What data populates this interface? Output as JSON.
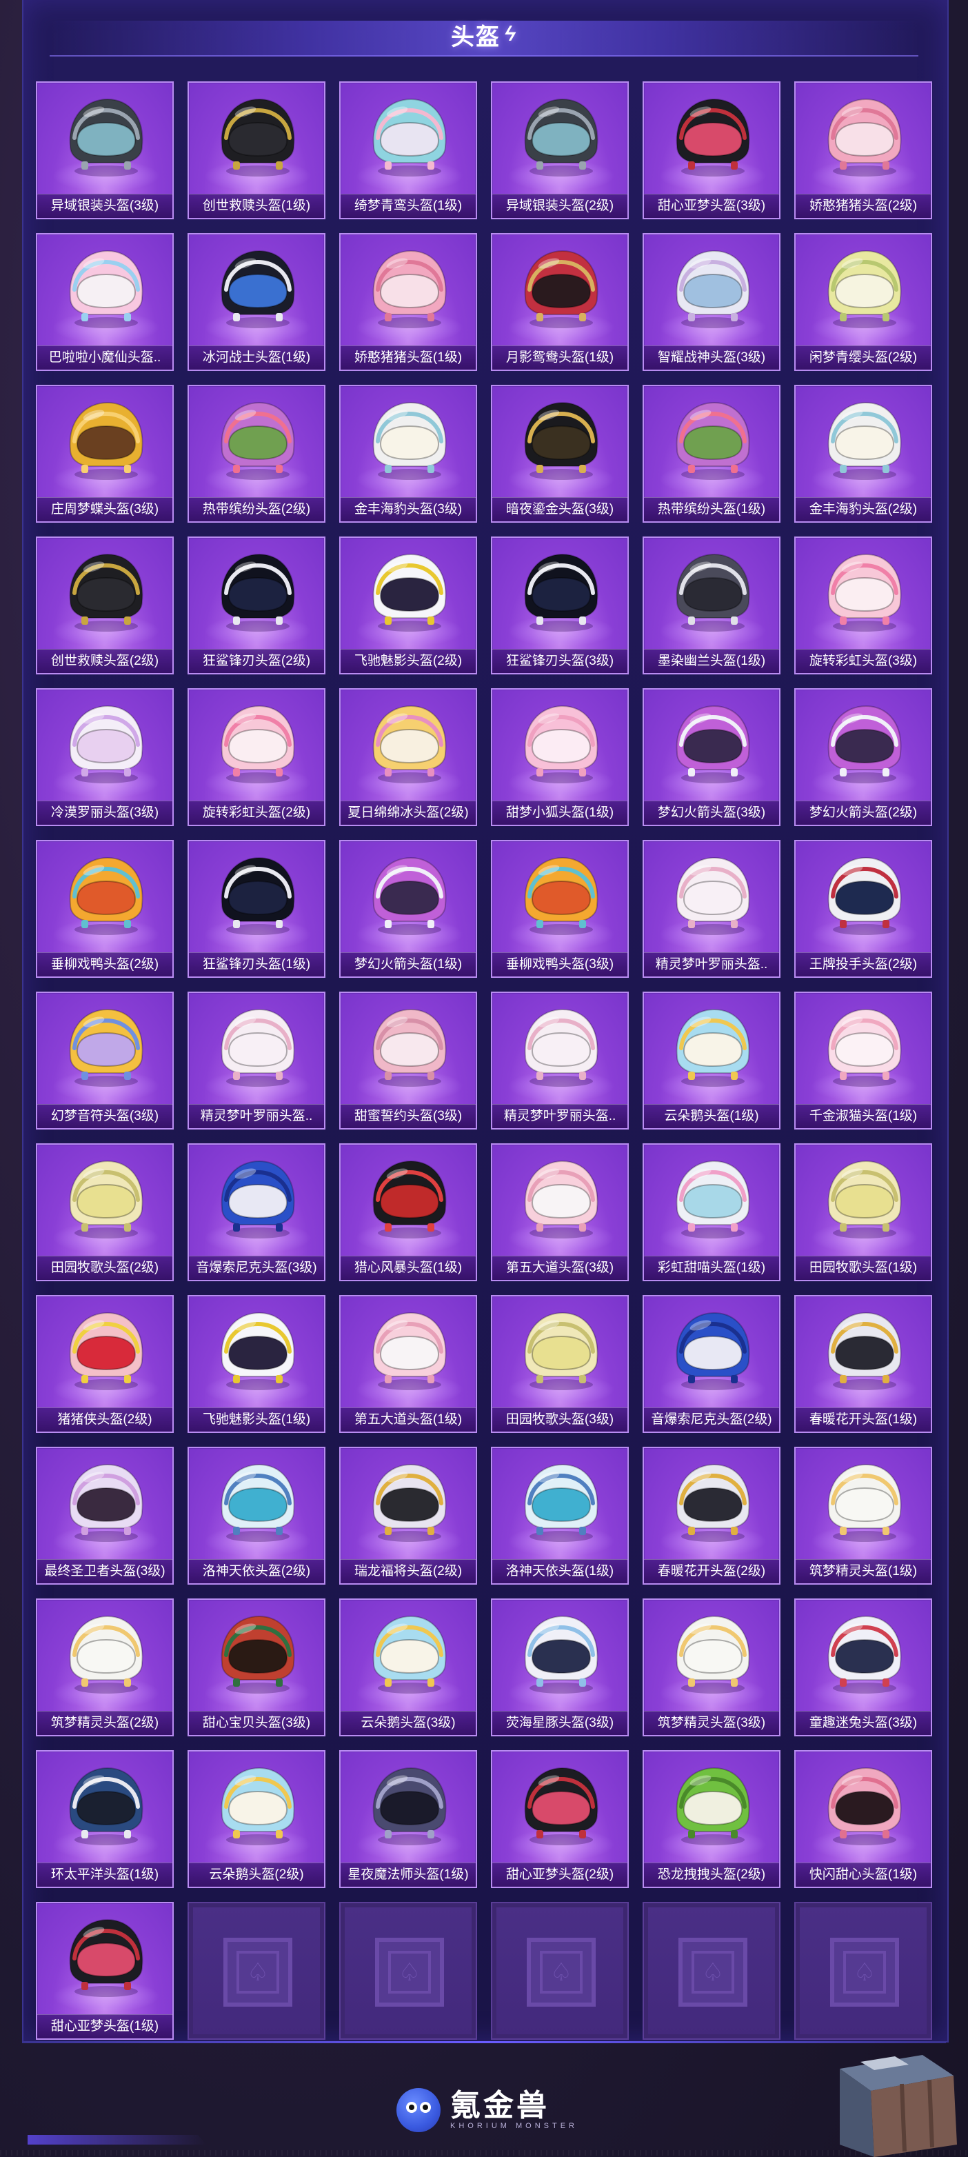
{
  "header": {
    "title": "头盔"
  },
  "items": [
    {
      "label": "异域银装头盔(3级)",
      "shell": "#3a4048",
      "visor": "#7fb2c0",
      "trim": "#9aa4b0"
    },
    {
      "label": "创世救赎头盔(1级)",
      "shell": "#1e1e22",
      "visor": "#2a2a30",
      "trim": "#c8a640"
    },
    {
      "label": "绮梦青鸾头盔(1级)",
      "shell": "#8fd4e0",
      "visor": "#e8e4f2",
      "trim": "#f4b8d0"
    },
    {
      "label": "异域银装头盔(2级)",
      "shell": "#3a4048",
      "visor": "#7fb2c0",
      "trim": "#9aa4b0"
    },
    {
      "label": "甜心亚梦头盔(3级)",
      "shell": "#1c1c22",
      "visor": "#d84a6a",
      "trim": "#c0303c"
    },
    {
      "label": "娇憨猪猪头盔(2级)",
      "shell": "#f2a8c0",
      "visor": "#f8e0e8",
      "trim": "#e07898"
    },
    {
      "label": "巴啦啦小魔仙头盔..",
      "shell": "#f8c8e0",
      "visor": "#f6f0f4",
      "trim": "#9ad0f0"
    },
    {
      "label": "冰河战士头盔(1级)",
      "shell": "#1a1c2a",
      "visor": "#3a70d0",
      "trim": "#e8e8f0"
    },
    {
      "label": "娇憨猪猪头盔(1级)",
      "shell": "#f2a8c0",
      "visor": "#f8e0e8",
      "trim": "#e07898"
    },
    {
      "label": "月影鸳鸯头盔(1级)",
      "shell": "#c23040",
      "visor": "#2a1a1e",
      "trim": "#d8b060"
    },
    {
      "label": "智耀战神头盔(3级)",
      "shell": "#e8e8f4",
      "visor": "#a0c0e0",
      "trim": "#c8b0e0"
    },
    {
      "label": "闲梦青缨头盔(2级)",
      "shell": "#e8e8a0",
      "visor": "#f6f4e0",
      "trim": "#b8c870"
    },
    {
      "label": "庄周梦蝶头盔(3级)",
      "shell": "#e8b030",
      "visor": "#6a4020",
      "trim": "#f8d070"
    },
    {
      "label": "热带缤纷头盔(2级)",
      "shell": "#c070d0",
      "visor": "#70a050",
      "trim": "#f07090"
    },
    {
      "label": "金丰海豹头盔(3级)",
      "shell": "#f0f0f0",
      "visor": "#f8f4e8",
      "trim": "#90c8d8"
    },
    {
      "label": "暗夜鎏金头盔(3级)",
      "shell": "#1a1a1e",
      "visor": "#3a3020",
      "trim": "#d8b050"
    },
    {
      "label": "热带缤纷头盔(1级)",
      "shell": "#c070d0",
      "visor": "#70a050",
      "trim": "#f07090"
    },
    {
      "label": "金丰海豹头盔(2级)",
      "shell": "#f0f0f0",
      "visor": "#f8f4e8",
      "trim": "#90c8d8"
    },
    {
      "label": "创世救赎头盔(2级)",
      "shell": "#1e1e22",
      "visor": "#2a2a30",
      "trim": "#c8a640"
    },
    {
      "label": "狂鲨锋刃头盔(2级)",
      "shell": "#10121e",
      "visor": "#1c2240",
      "trim": "#e8e8f0"
    },
    {
      "label": "飞驰魅影头盔(2级)",
      "shell": "#f6f6fa",
      "visor": "#2a2440",
      "trim": "#e8c830"
    },
    {
      "label": "狂鲨锋刃头盔(3级)",
      "shell": "#10121e",
      "visor": "#1c2240",
      "trim": "#e8e8f0"
    },
    {
      "label": "墨染幽兰头盔(1级)",
      "shell": "#4a4a5a",
      "visor": "#2a2a34",
      "trim": "#e0e0e8"
    },
    {
      "label": "旋转彩虹头盔(3级)",
      "shell": "#f8c8d8",
      "visor": "#fbeef2",
      "trim": "#f080a8"
    },
    {
      "label": "冷漠罗丽头盔(3级)",
      "shell": "#f4eef8",
      "visor": "#e8d0f0",
      "trim": "#d0a8e8"
    },
    {
      "label": "旋转彩虹头盔(2级)",
      "shell": "#f8c8d8",
      "visor": "#fbeef2",
      "trim": "#f080a8"
    },
    {
      "label": "夏日绵绵冰头盔(2级)",
      "shell": "#f6d070",
      "visor": "#f8f0e0",
      "trim": "#e890c0"
    },
    {
      "label": "甜梦小狐头盔(1级)",
      "shell": "#f8c0d8",
      "visor": "#fcecf4",
      "trim": "#f0a0c0"
    },
    {
      "label": "梦幻火箭头盔(3级)",
      "shell": "#c060d8",
      "visor": "#3a2a50",
      "trim": "#f0f0f8"
    },
    {
      "label": "梦幻火箭头盔(2级)",
      "shell": "#c060d8",
      "visor": "#3a2a50",
      "trim": "#f0f0f8"
    },
    {
      "label": "垂柳戏鸭头盔(2级)",
      "shell": "#f4a830",
      "visor": "#e05a2a",
      "trim": "#60c0d0"
    },
    {
      "label": "狂鲨锋刃头盔(1级)",
      "shell": "#10121e",
      "visor": "#1c2240",
      "trim": "#e8e8f0"
    },
    {
      "label": "梦幻火箭头盔(1级)",
      "shell": "#c060d8",
      "visor": "#3a2a50",
      "trim": "#f0f0f8"
    },
    {
      "label": "垂柳戏鸭头盔(3级)",
      "shell": "#f4a830",
      "visor": "#e05a2a",
      "trim": "#60c0d0"
    },
    {
      "label": "精灵梦叶罗丽头盔..",
      "shell": "#f6eef4",
      "visor": "#f8f0f6",
      "trim": "#e8b0c8"
    },
    {
      "label": "王牌投手头盔(2级)",
      "shell": "#f0f0f4",
      "visor": "#1e2a50",
      "trim": "#c03040"
    },
    {
      "label": "幻梦音符头盔(3级)",
      "shell": "#f4c040",
      "visor": "#c0a8e8",
      "trim": "#7090e0"
    },
    {
      "label": "精灵梦叶罗丽头盔..",
      "shell": "#f6eef4",
      "visor": "#f8f0f6",
      "trim": "#e8b0c8"
    },
    {
      "label": "甜蜜誓约头盔(3级)",
      "shell": "#f0b8c8",
      "visor": "#f8e8ee",
      "trim": "#d890a8"
    },
    {
      "label": "精灵梦叶罗丽头盔..",
      "shell": "#f6eef4",
      "visor": "#f8f0f6",
      "trim": "#e8b0c8"
    },
    {
      "label": "云朵鹅头盔(1级)",
      "shell": "#a8dcf0",
      "visor": "#f8f4e8",
      "trim": "#f0c850"
    },
    {
      "label": "千金淑猫头盔(1级)",
      "shell": "#fadce8",
      "visor": "#fcf2f6",
      "trim": "#f0a8c0"
    },
    {
      "label": "田园牧歌头盔(2级)",
      "shell": "#f0e8b8",
      "visor": "#e8e090",
      "trim": "#c8c070"
    },
    {
      "label": "音爆索尼克头盔(3级)",
      "shell": "#2a50c8",
      "visor": "#e8e8f4",
      "trim": "#1a3090"
    },
    {
      "label": "猎心风暴头盔(1级)",
      "shell": "#1a1a1e",
      "visor": "#c02a2a",
      "trim": "#e04040"
    },
    {
      "label": "第五大道头盔(3级)",
      "shell": "#f8d0dc",
      "visor": "#f8f4f6",
      "trim": "#e8a0b8"
    },
    {
      "label": "彩虹甜喵头盔(1级)",
      "shell": "#eef0f6",
      "visor": "#a8d8e8",
      "trim": "#f0a0c8"
    },
    {
      "label": "田园牧歌头盔(1级)",
      "shell": "#f0e8b8",
      "visor": "#e8e090",
      "trim": "#c8c070"
    },
    {
      "label": "猪猪侠头盔(2级)",
      "shell": "#f4c0c8",
      "visor": "#d82a3a",
      "trim": "#f0d040"
    },
    {
      "label": "飞驰魅影头盔(1级)",
      "shell": "#f6f6fa",
      "visor": "#2a2440",
      "trim": "#e8c830"
    },
    {
      "label": "第五大道头盔(1级)",
      "shell": "#f8d0dc",
      "visor": "#f8f4f6",
      "trim": "#e8a0b8"
    },
    {
      "label": "田园牧歌头盔(3级)",
      "shell": "#f0e8b8",
      "visor": "#e8e090",
      "trim": "#c8c070"
    },
    {
      "label": "音爆索尼克头盔(2级)",
      "shell": "#2a50c8",
      "visor": "#e8e8f4",
      "trim": "#1a3090"
    },
    {
      "label": "春暖花开头盔(1级)",
      "shell": "#e8e8f0",
      "visor": "#2a2a34",
      "trim": "#e0b040"
    },
    {
      "label": "最终圣卫者头盔(3级)",
      "shell": "#e8dcf4",
      "visor": "#3a2a40",
      "trim": "#d0a0e0"
    },
    {
      "label": "洛神天依头盔(2级)",
      "shell": "#e0f0f8",
      "visor": "#40b0d0",
      "trim": "#5080c0"
    },
    {
      "label": "瑞龙福将头盔(2级)",
      "shell": "#e8e4f0",
      "visor": "#2a2a30",
      "trim": "#e0b040"
    },
    {
      "label": "洛神天依头盔(1级)",
      "shell": "#e0f0f8",
      "visor": "#40b0d0",
      "trim": "#5080c0"
    },
    {
      "label": "春暖花开头盔(2级)",
      "shell": "#e8e8f0",
      "visor": "#2a2a34",
      "trim": "#e0b040"
    },
    {
      "label": "筑梦精灵头盔(1级)",
      "shell": "#f4f4f0",
      "visor": "#f8f8f4",
      "trim": "#f0c870"
    },
    {
      "label": "筑梦精灵头盔(2级)",
      "shell": "#f4f4f0",
      "visor": "#f8f8f4",
      "trim": "#f0c870"
    },
    {
      "label": "甜心宝贝头盔(3级)",
      "shell": "#c04030",
      "visor": "#2a1a14",
      "trim": "#307040"
    },
    {
      "label": "云朵鹅头盔(3级)",
      "shell": "#a8dcf0",
      "visor": "#f8f4e8",
      "trim": "#f0c850"
    },
    {
      "label": "荧海星豚头盔(3级)",
      "shell": "#f0f0f8",
      "visor": "#2a3050",
      "trim": "#90c0e8"
    },
    {
      "label": "筑梦精灵头盔(3级)",
      "shell": "#f4f4f0",
      "visor": "#f8f8f4",
      "trim": "#f0c870"
    },
    {
      "label": "童趣迷兔头盔(3级)",
      "shell": "#f0f0f8",
      "visor": "#2a3050",
      "trim": "#d04050"
    },
    {
      "label": "环太平洋头盔(1级)",
      "shell": "#2a4a80",
      "visor": "#1a2030",
      "trim": "#e8e8f0"
    },
    {
      "label": "云朵鹅头盔(2级)",
      "shell": "#a8dcf0",
      "visor": "#f8f4e8",
      "trim": "#f0c850"
    },
    {
      "label": "星夜魔法师头盔(1级)",
      "shell": "#4a4a70",
      "visor": "#1a1a2a",
      "trim": "#a0a0c8"
    },
    {
      "label": "甜心亚梦头盔(2级)",
      "shell": "#1c1c22",
      "visor": "#d84a6a",
      "trim": "#c0303c"
    },
    {
      "label": "恐龙拽拽头盔(2级)",
      "shell": "#70c040",
      "visor": "#f0f0e0",
      "trim": "#4a8a2a"
    },
    {
      "label": "快闪甜心头盔(1级)",
      "shell": "#f0a8c0",
      "visor": "#2a1a20",
      "trim": "#e07090"
    },
    {
      "label": "甜心亚梦头盔(1级)",
      "shell": "#1c1c22",
      "visor": "#d84a6a",
      "trim": "#c0303c"
    }
  ],
  "empty_slots": 5,
  "footer": {
    "logo_main": "氪金兽",
    "logo_sub": "KHORIUM MONSTER"
  }
}
